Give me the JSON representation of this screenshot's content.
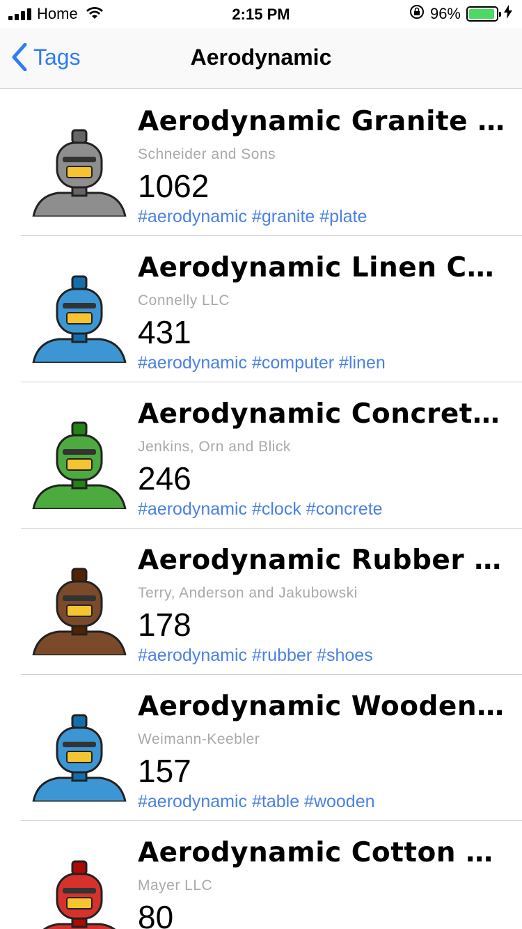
{
  "status": {
    "carrier": "Home",
    "time": "2:15 PM",
    "battery_percent": "96%",
    "battery_level": 0.96,
    "battery_color": "#4cd964"
  },
  "nav": {
    "back_label": "Tags",
    "title": "Aerodynamic",
    "accent": "#2f7cf6"
  },
  "items": [
    {
      "title": "Aerodynamic Granite Pl…",
      "company": "Schneider and Sons",
      "count": "1062",
      "tags": "#aerodynamic #granite #plate",
      "robot_color": "#8e8e8e"
    },
    {
      "title": "Aerodynamic Linen Com…",
      "company": "Connelly LLC",
      "count": "431",
      "tags": "#aerodynamic #computer #linen",
      "robot_color": "#3d96d4"
    },
    {
      "title": "Aerodynamic Concrete…",
      "company": "Jenkins, Orn and Blick",
      "count": "246",
      "tags": "#aerodynamic #clock #concrete",
      "robot_color": "#4caa3e"
    },
    {
      "title": "Aerodynamic Rubber Sh…",
      "company": "Terry, Anderson and Jakubowski",
      "count": "178",
      "tags": "#aerodynamic #rubber #shoes",
      "robot_color": "#7a4a2a"
    },
    {
      "title": "Aerodynamic Wooden T…",
      "company": "Weimann-Keebler",
      "count": "157",
      "tags": "#aerodynamic #table #wooden",
      "robot_color": "#3d96d4"
    },
    {
      "title": "Aerodynamic Cotton Ke…",
      "company": "Mayer LLC",
      "count": "80",
      "tags": "",
      "robot_color": "#d6322b"
    }
  ]
}
